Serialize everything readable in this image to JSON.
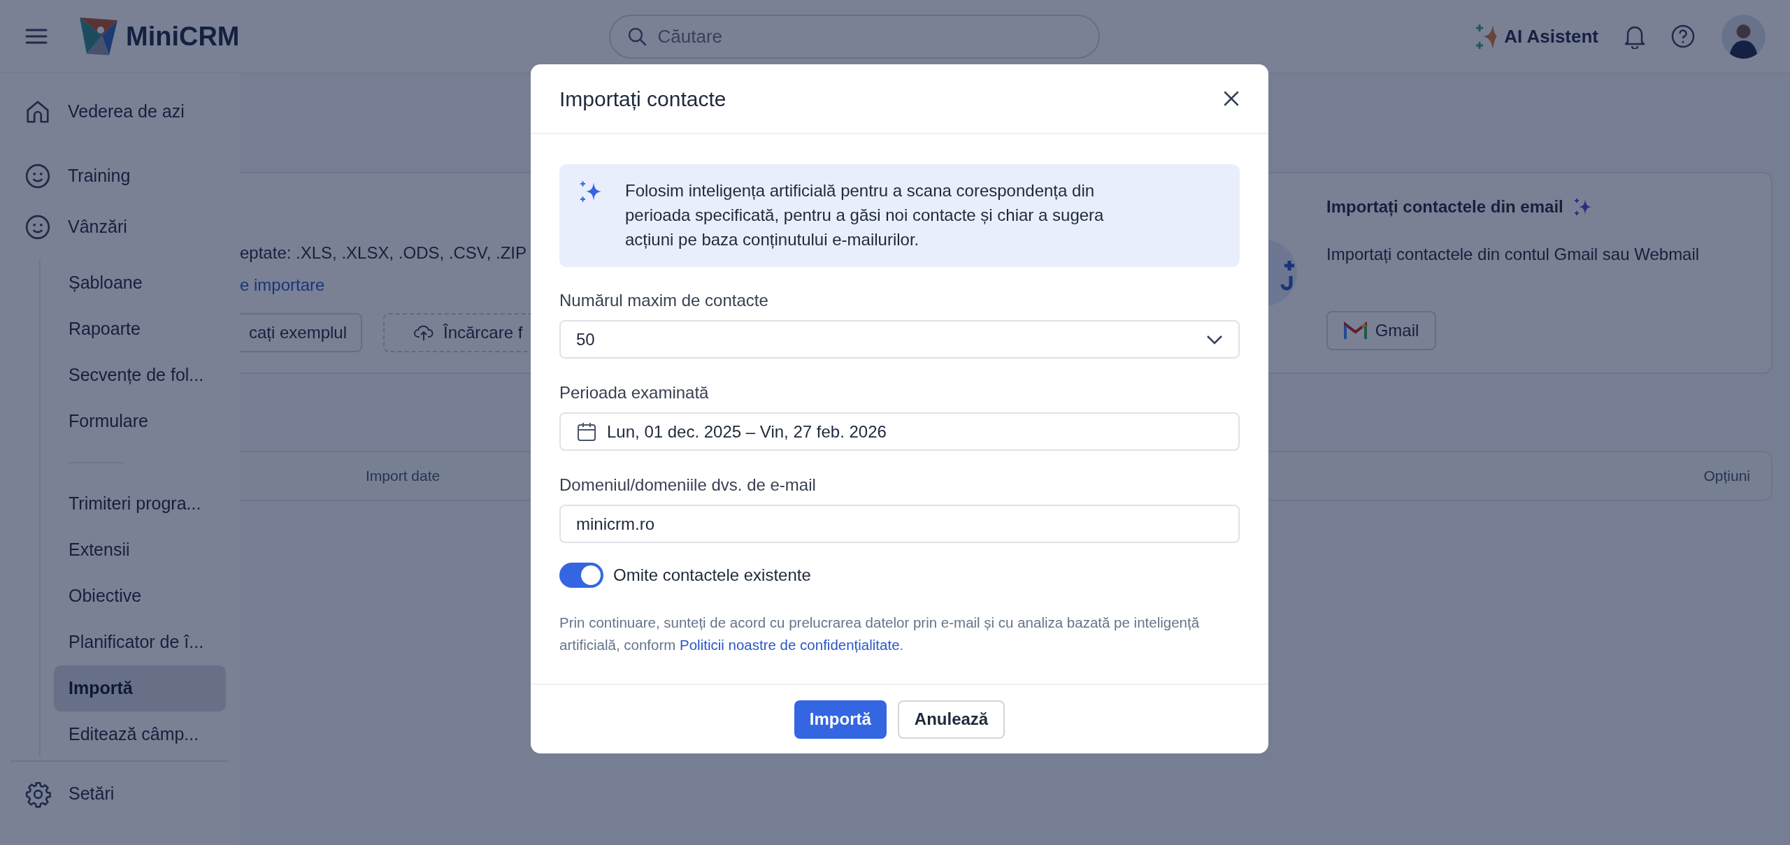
{
  "topbar": {
    "logo_text": "MiniCRM",
    "search": {
      "placeholder": "Căutare"
    },
    "ai_assistant": "AI Asistent"
  },
  "sidebar": {
    "main_items": [
      {
        "label": "Vederea de azi"
      },
      {
        "label": "Training"
      },
      {
        "label": "Vânzări"
      }
    ],
    "sub_groups": [
      [
        {
          "label": "Șabloane",
          "selected": false
        },
        {
          "label": "Rapoarte",
          "selected": false
        },
        {
          "label": "Secvențe de fol...",
          "selected": false
        },
        {
          "label": "Formulare",
          "selected": false
        }
      ],
      [
        {
          "label": "Trimiteri progra...",
          "selected": false
        },
        {
          "label": "Extensii",
          "selected": false
        },
        {
          "label": "Obiective",
          "selected": false
        },
        {
          "label": "Planificator de î...",
          "selected": false
        },
        {
          "label": "Importă",
          "selected": true
        },
        {
          "label": "Editează câmp...",
          "selected": false
        }
      ]
    ],
    "footer_item": {
      "label": "Setări"
    }
  },
  "file_import_card": {
    "formats_text": "eptate: .XLS, .XLSX, .ODS, .CSV, .ZIP",
    "link": "e importare",
    "buttons": [
      {
        "kind": "outline",
        "label": "cați exemplul"
      },
      {
        "kind": "upload",
        "label": "Încărcare f"
      }
    ]
  },
  "email_import_card": {
    "title": "Importați contactele din email",
    "description": "Importați contactele din contul Gmail sau Webmail",
    "button": "Gmail"
  },
  "table": {
    "columns": [
      "Import date",
      "Opțiuni"
    ]
  },
  "dialog": {
    "title": "Importați contacte",
    "info": "Folosim inteligența artificială pentru a scana corespondența din perioada specificată, pentru a găsi noi contacte și chiar a sugera acțiuni pe baza conținutului e-mailurilor.",
    "max_contacts": {
      "label": "Numărul maxim de contacte",
      "value": "50"
    },
    "period": {
      "label": "Perioada examinată",
      "value": "Lun, 01 dec. 2025 – Vin, 27 feb. 2026"
    },
    "domain": {
      "label": "Domeniul/domeniile dvs. de e-mail",
      "value": "minicrm.ro"
    },
    "skip_existing": {
      "label": "Omite contactele existente",
      "on": true
    },
    "consent": {
      "text": "Prin continuare, sunteți de acord cu prelucrarea datelor prin e-mail și cu analiza bazată pe inteligență artificială, conform ",
      "link": "Politicii noastre de confidențialitate",
      "text_after": "."
    },
    "buttons": [
      {
        "kind": "primary",
        "label": "Importă"
      },
      {
        "kind": "secondary",
        "label": "Anulează"
      }
    ]
  }
}
